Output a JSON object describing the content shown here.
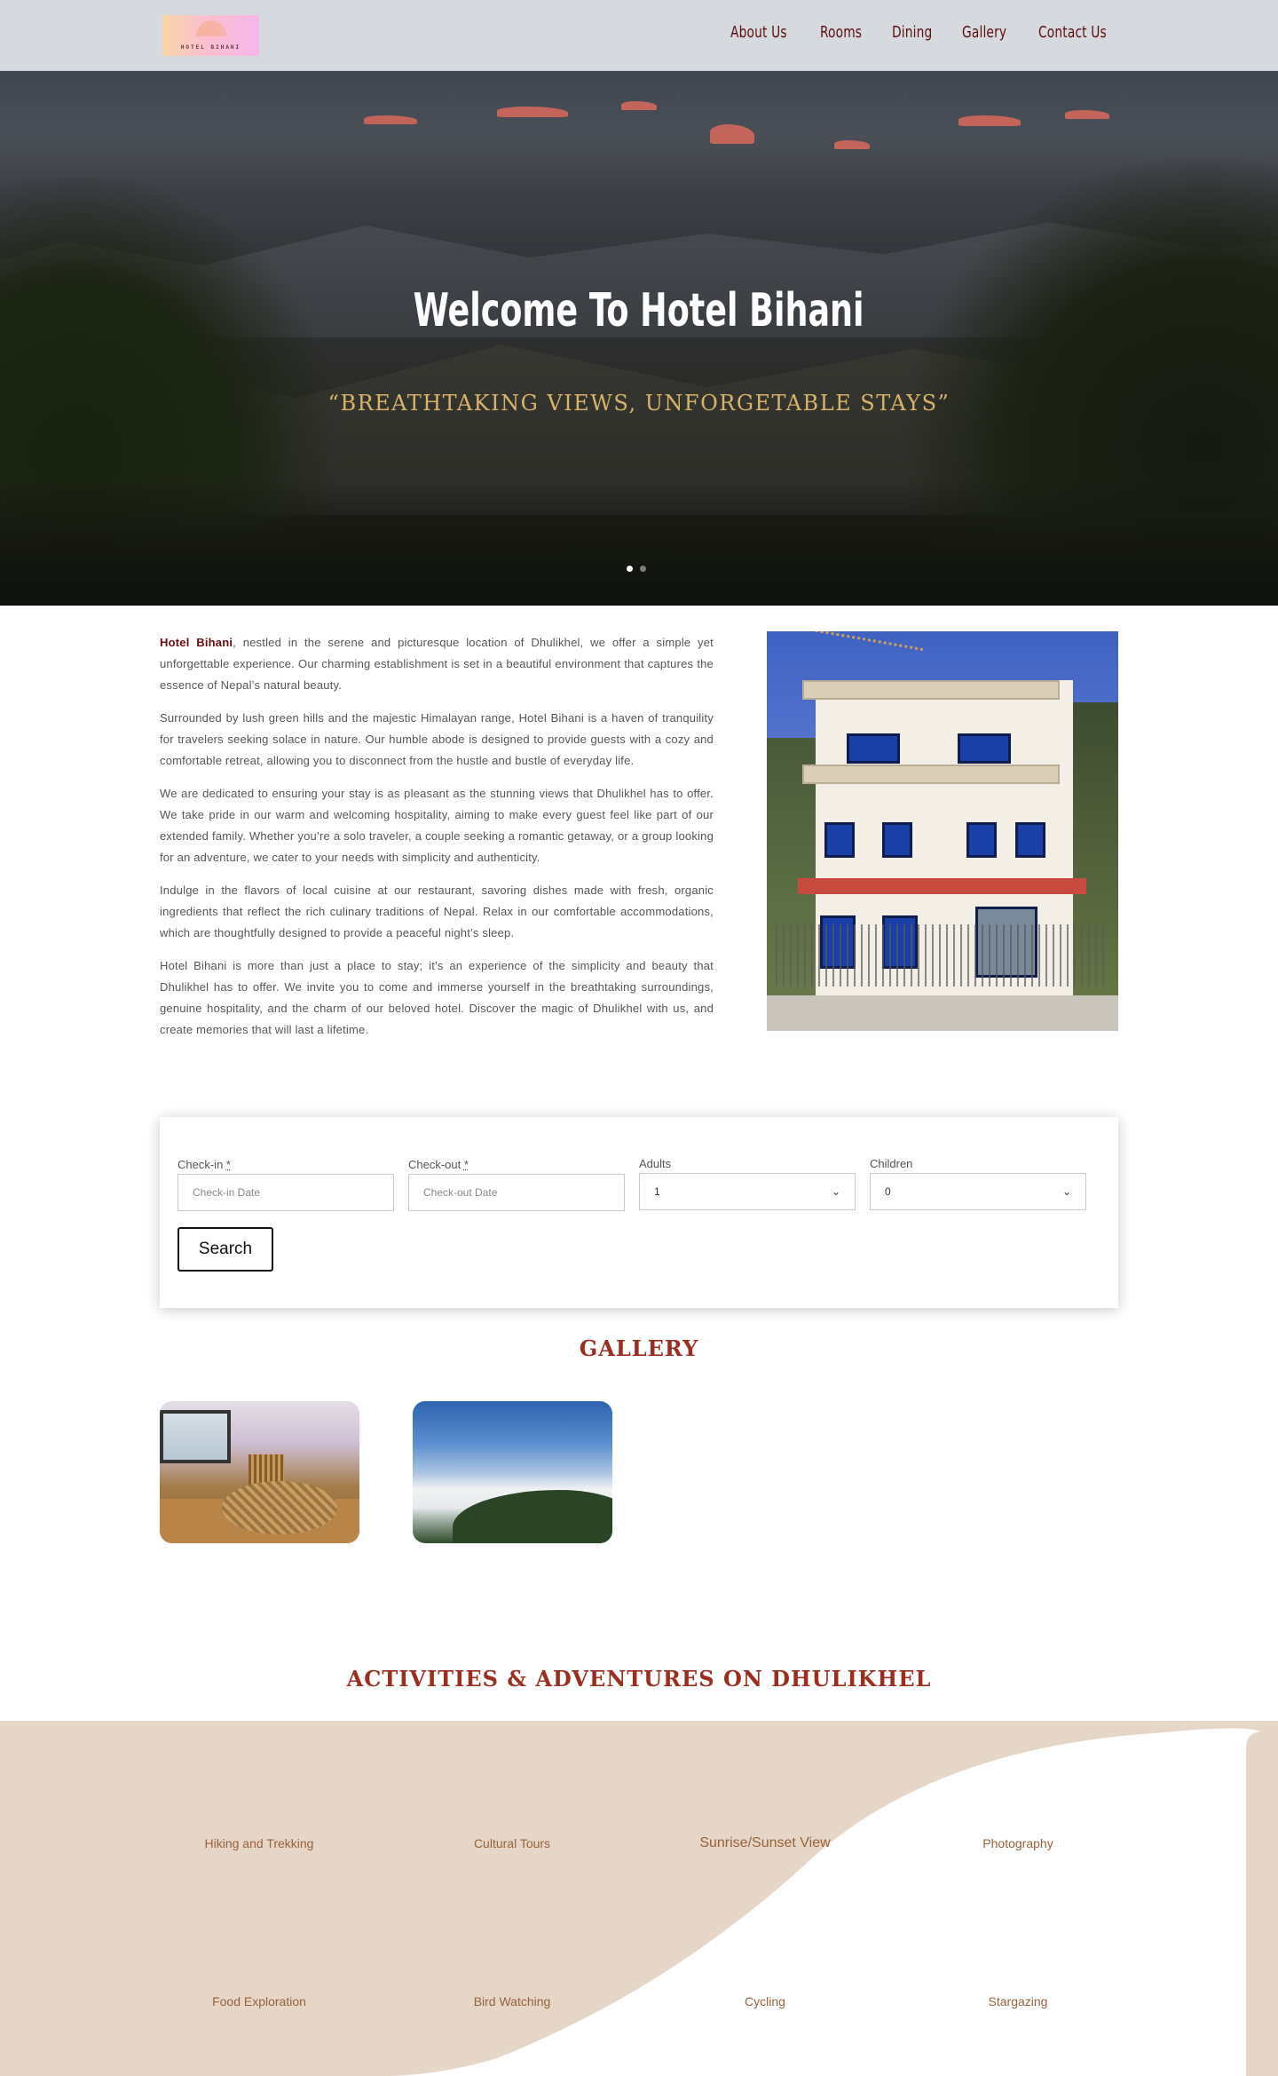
{
  "header": {
    "logo_text": "HOTEL BIHANI",
    "nav": [
      "About Us",
      "Rooms",
      "Dining",
      "Gallery",
      "Contact Us"
    ]
  },
  "hero": {
    "title": "Welcome To Hotel Bihani",
    "subtitle": "“BREATHTAKING VIEWS, UNFORGETABLE STAYS”",
    "slides": 2,
    "active_slide": 1
  },
  "about": {
    "brand": "Hotel Bihani",
    "p1_rest": ", nestled in the serene and picturesque location of Dhulikhel, we offer a simple yet unforgettable experience. Our charming establishment is set in a beautiful environment that captures the essence of Nepal’s natural beauty.",
    "p2": "Surrounded by lush green hills and the majestic Himalayan range, Hotel Bihani is a haven of tranquility for travelers seeking solace in nature. Our humble abode is designed to provide guests with a cozy and comfortable retreat, allowing you to disconnect from the hustle and bustle of everyday life.",
    "p3": "We are dedicated to ensuring your stay is as pleasant as the stunning views that Dhulikhel has to offer. We take pride in our warm and welcoming hospitality, aiming to make every guest feel like part of our extended family. Whether you’re a solo traveler, a couple seeking a romantic getaway, or a group looking for an adventure, we cater to your needs with simplicity and authenticity.",
    "p4": "Indulge in the flavors of local cuisine at our restaurant, savoring dishes made with fresh, organic ingredients that reflect the rich culinary traditions of Nepal. Relax in our comfortable accommodations, which are thoughtfully designed to provide a peaceful night’s sleep.",
    "p5": "Hotel Bihani is more than just a place to stay; it’s an experience of the simplicity and beauty that Dhulikhel has to offer. We invite you to come and immerse yourself in the breathtaking surroundings, genuine hospitality, and the charm of our beloved hotel. Discover the magic of Dhulikhel with us, and create memories that will last a lifetime."
  },
  "booking": {
    "checkin_label": "Check-in",
    "checkout_label": "Check-out",
    "required_mark": "*",
    "adults_label": "Adults",
    "children_label": "Children",
    "checkin_placeholder": "Check-in Date",
    "checkout_placeholder": "Check-out Date",
    "adults_value": "1",
    "children_value": "0",
    "search_label": "Search"
  },
  "gallery": {
    "title": "GALLERY"
  },
  "activities": {
    "title": "ACTIVITIES & ADVENTURES ON DHULIKHEL",
    "items": [
      "Hiking and Trekking",
      "Cultural Tours",
      "Sunrise/Sunset View",
      "Photography",
      "Food Exploration",
      "Bird Watching",
      "Cycling",
      "Stargazing"
    ]
  },
  "colors": {
    "brand": "#6b0d0d",
    "accent_title": "#9b2f1f",
    "subtitle_gold": "#d9b36b",
    "activity_bg": "#e6d6c8",
    "activity_text": "#96623a"
  }
}
